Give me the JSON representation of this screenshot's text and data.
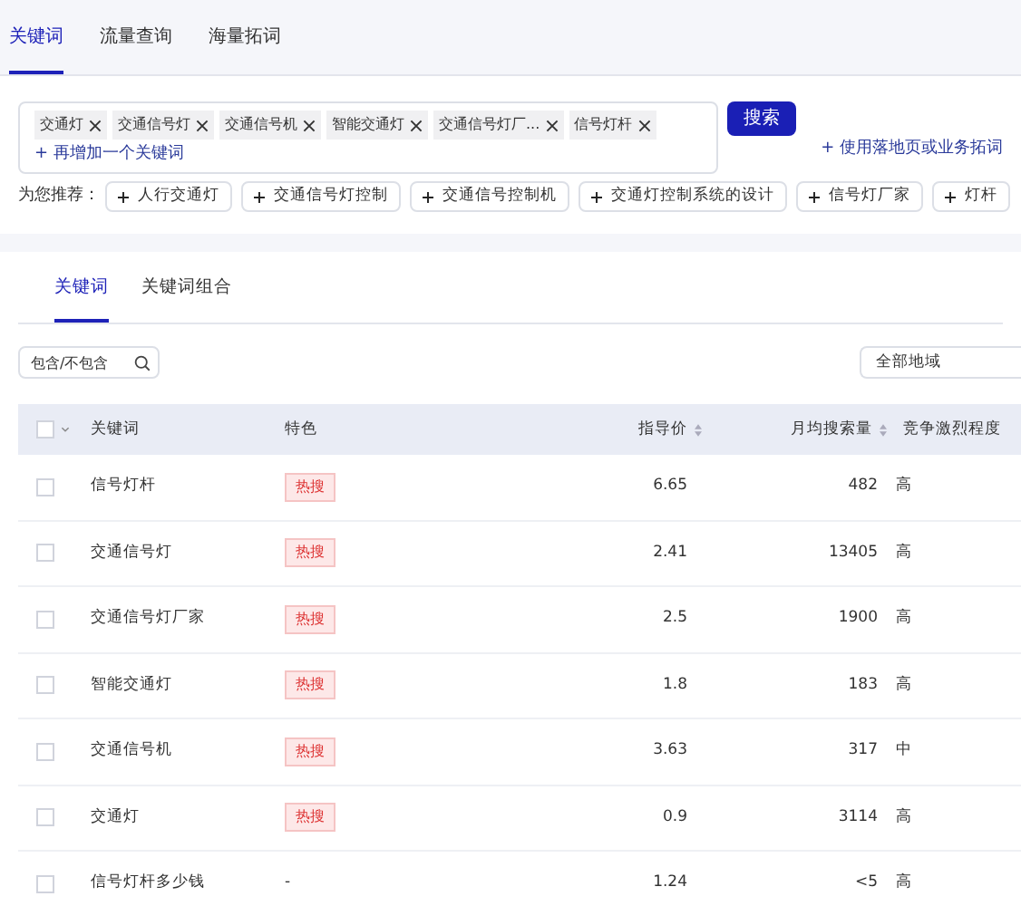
{
  "top_tabs": [
    {
      "label": "关键词",
      "selected": true
    },
    {
      "label": "流量查询",
      "selected": false
    },
    {
      "label": "海量拓词",
      "selected": false
    }
  ],
  "keyword_input": {
    "tags": [
      "交通灯",
      "交通信号灯",
      "交通信号机",
      "智能交通灯",
      "交通信号灯厂...",
      "信号灯杆"
    ],
    "add_link": "+ 再增加一个关键词"
  },
  "search_button": "搜索",
  "landing_link": "+ 使用落地页或业务拓词",
  "recommend": {
    "label": "为您推荐：",
    "items": [
      "人行交通灯",
      "交通信号灯控制",
      "交通信号控制机",
      "交通灯控制系统的设计",
      "信号灯厂家",
      "灯杆"
    ]
  },
  "result_tabs": [
    {
      "label": "关键词",
      "selected": true
    },
    {
      "label": "关键词组合",
      "selected": false
    }
  ],
  "filter": {
    "placeholder": "包含/不包含"
  },
  "region_select": "全部地域",
  "table": {
    "select_all": {
      "checked": false
    },
    "columns": [
      "关键词",
      "特色",
      "指导价",
      "月均搜索量",
      "竞争激烈程度"
    ],
    "rows": [
      {
        "keyword": "信号灯杆",
        "feature": "热搜",
        "price": "6.65",
        "volume": "482",
        "competition": "高",
        "checked": false
      },
      {
        "keyword": "交通信号灯",
        "feature": "热搜",
        "price": "2.41",
        "volume": "13405",
        "competition": "高",
        "checked": false
      },
      {
        "keyword": "交通信号灯厂家",
        "feature": "热搜",
        "price": "2.5",
        "volume": "1900",
        "competition": "高",
        "checked": false
      },
      {
        "keyword": "智能交通灯",
        "feature": "热搜",
        "price": "1.8",
        "volume": "183",
        "competition": "高",
        "checked": false
      },
      {
        "keyword": "交通信号机",
        "feature": "热搜",
        "price": "3.63",
        "volume": "317",
        "competition": "中",
        "checked": false
      },
      {
        "keyword": "交通灯",
        "feature": "热搜",
        "price": "0.9",
        "volume": "3114",
        "competition": "高",
        "checked": false
      },
      {
        "keyword": "信号灯杆多少钱",
        "feature": "-",
        "price": "1.24",
        "volume": "<5",
        "competition": "高",
        "checked": false
      }
    ]
  }
}
